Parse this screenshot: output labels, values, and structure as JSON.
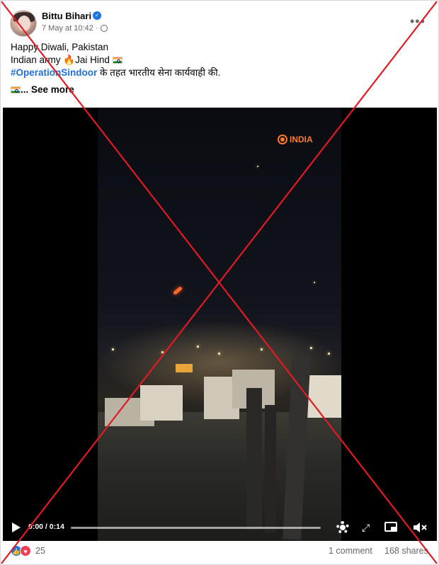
{
  "post": {
    "author": "Bittu Bihari",
    "timestamp": "7 May at 10:42 ·",
    "lines": {
      "l1": "Happy Diwali, Pakistan",
      "l2a": "Indian army ",
      "l2b": "Jai Hind ",
      "hashtag": "#OperationSindoor",
      "l3b": " के तहत भारतीय सेना कार्यवाही की.",
      "see_more": "... See more"
    },
    "icons": {
      "verified": "verified-badge-icon",
      "privacy": "globe-icon",
      "menu": "more-options-icon"
    }
  },
  "video": {
    "watermark": "INDIA",
    "time": "0:00 / 0:14",
    "progress": 0.0,
    "controls": [
      "play-icon",
      "settings-gear-icon",
      "fullscreen-icon",
      "picture-in-picture-icon",
      "mute-icon"
    ]
  },
  "footer": {
    "reaction_count": "25",
    "comments": "1 comment",
    "shares": "168 shares"
  },
  "colors": {
    "overlay_cross": "#e01b24",
    "link": "#216fdb",
    "secondary": "#65676b"
  }
}
